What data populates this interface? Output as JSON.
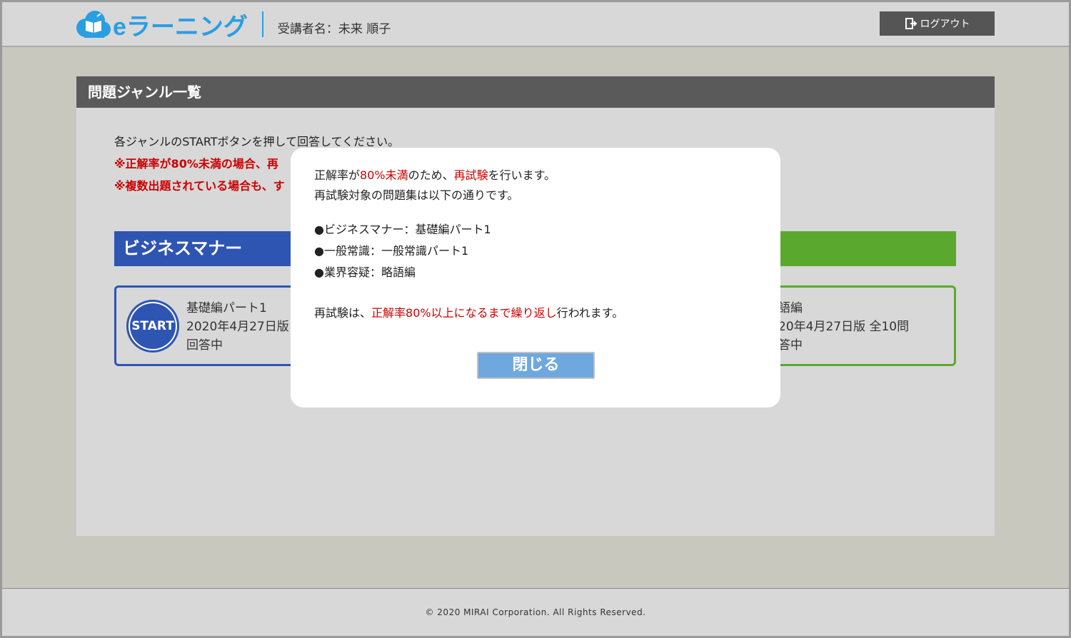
{
  "header": {
    "logo_text": "eラーニング",
    "user_label": "受講者名：未来 順子",
    "logout_label": "ログアウト"
  },
  "panel": {
    "title": "問題ジャンル一覧",
    "instructions": [
      "各ジャンルのSTARTボタンを押して回答してください。",
      "※正解率が80%未満の場合、再",
      "※複数出題されている場合も、す"
    ]
  },
  "genres": [
    {
      "header": "ビジネスマナー",
      "start_label": "START",
      "title": "基礎編パート1",
      "version": "2020年4月27日版",
      "status": "回答中"
    },
    {
      "header": "",
      "title": "語編",
      "version": "20年4月27日版 全10問",
      "status": "答中"
    }
  ],
  "modal": {
    "line1_a": "正解率が",
    "line1_b": "80%未満",
    "line1_c": "のため、",
    "line1_d": "再試験",
    "line1_e": "を行います。",
    "line2": "再試験対象の問題集は以下の通りです。",
    "items": [
      "●ビジネスマナー：基礎編パート1",
      "●一般常識：一般常識パート1",
      "●業界容疑：略語編"
    ],
    "line3_a": "再試験は、",
    "line3_b": "正解率80%以上になるまで繰り返し",
    "line3_c": "行われます。",
    "close_label": "閉じる"
  },
  "footer": {
    "copyright": "© 2020 MIRAI Corporation. All Rights Reserved."
  },
  "colors": {
    "accent_blue": "#2f55b3",
    "accent_green": "#5aa92e",
    "logo_blue": "#2a9ee3",
    "alert_red": "#cc0000",
    "close_button": "#6fa8de"
  },
  "icons": {
    "logo": "book-cloud-icon",
    "logout": "logout-icon"
  }
}
